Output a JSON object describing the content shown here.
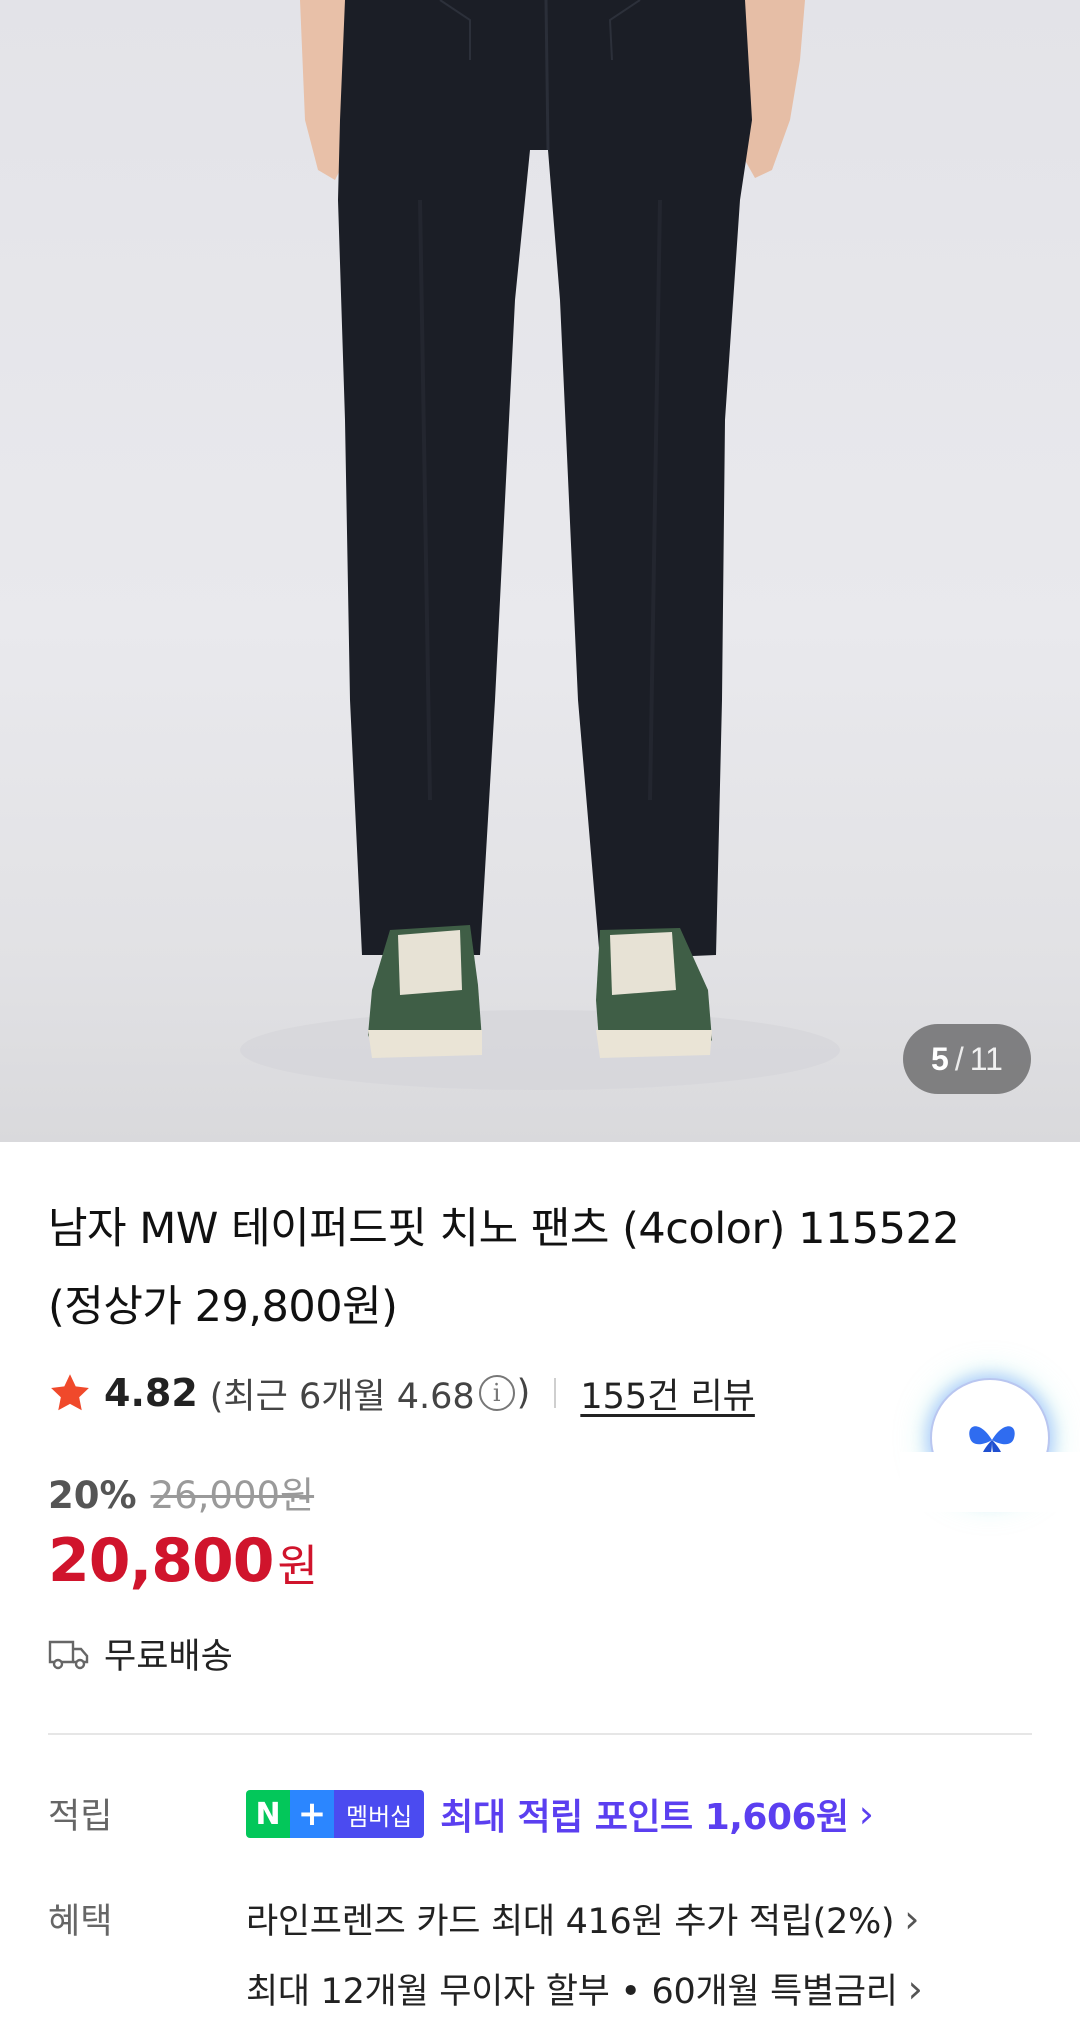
{
  "image": {
    "current": "5",
    "separator": "/",
    "total": "11"
  },
  "product": {
    "title_line1": "남자 MW 테이퍼드핏 치노 팬츠 (4color) 115522",
    "title_line2": "(정상가 29,800원)"
  },
  "rating": {
    "score": "4.82",
    "recent_prefix": "(최근 6개월 4.68",
    "recent_suffix": ")",
    "info_glyph": "i",
    "review_link": "155건 리뷰"
  },
  "price": {
    "discount": "20%",
    "original": "26,000원",
    "sale": "20,800",
    "currency": "원"
  },
  "shipping": {
    "label": "무료배송"
  },
  "points": {
    "label": "적립",
    "badge_n": "N",
    "badge_plus": "+",
    "badge_member": "멤버십",
    "text": "최대 적립 포인트 1,606원"
  },
  "benefits": {
    "label": "혜택",
    "items": [
      "라인프렌즈 카드 최대 416원 추가 적립(2%)",
      "최대 12개월 무이자 할부 • 60개월 특별금리"
    ]
  },
  "colors": {
    "price_red": "#d0142c",
    "point_purple": "#5b3ff0",
    "naver_green": "#03c75a",
    "star_red": "#f0492b"
  }
}
